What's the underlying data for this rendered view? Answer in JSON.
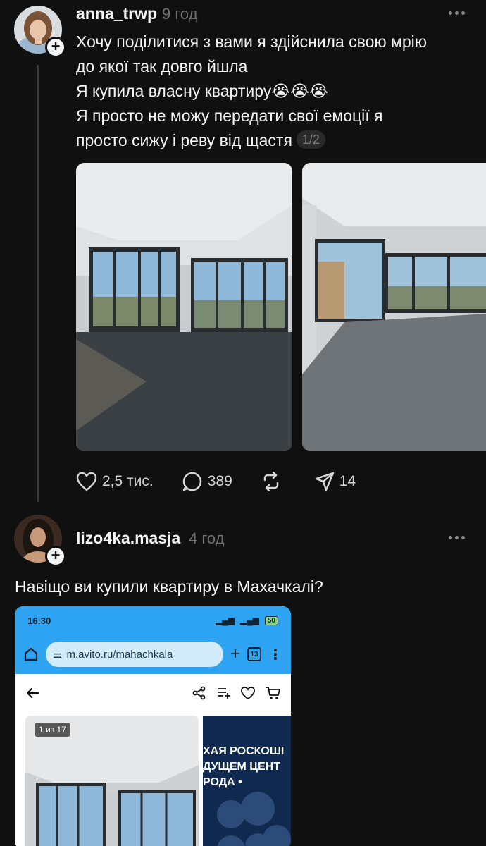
{
  "post1": {
    "username": "anna_trwp",
    "time": "9 год",
    "lines": [
      "Хочу поділитися з вами я здійснила свою мрію",
      "до якої так довго йшла",
      "Я купила власну квартиру😭😭😭",
      "Я просто не можу передати свої емоції я",
      "просто сижу і реву від щастя"
    ],
    "counter": "1/2",
    "likes": "2,5 тис.",
    "comments": "389",
    "reposts": "",
    "shares": "14"
  },
  "post2": {
    "username": "lizo4ka.masja",
    "time": "4 год",
    "text": "Навіщо ви купили квартиру в Махачкалі?"
  },
  "screenshot": {
    "clock": "16:30",
    "battery": "50",
    "url": "m.avito.ru/mahachkala",
    "tabs": "13",
    "photo_counter": "1 из 17",
    "promo_lines": [
      "ХАЯ РОСКОШІ",
      "ДУЩЕМ ЦЕНТ",
      "РОДА •"
    ]
  },
  "colors": {
    "background": "#101010",
    "text": "#f3f5f7",
    "muted": "#6f6f6f",
    "browser_bar": "#2ea3f2"
  },
  "icons": [
    "plus-icon",
    "more-icon",
    "heart-icon",
    "comment-icon",
    "repost-icon",
    "share-icon",
    "home-icon",
    "back-arrow-icon",
    "cart-icon"
  ]
}
